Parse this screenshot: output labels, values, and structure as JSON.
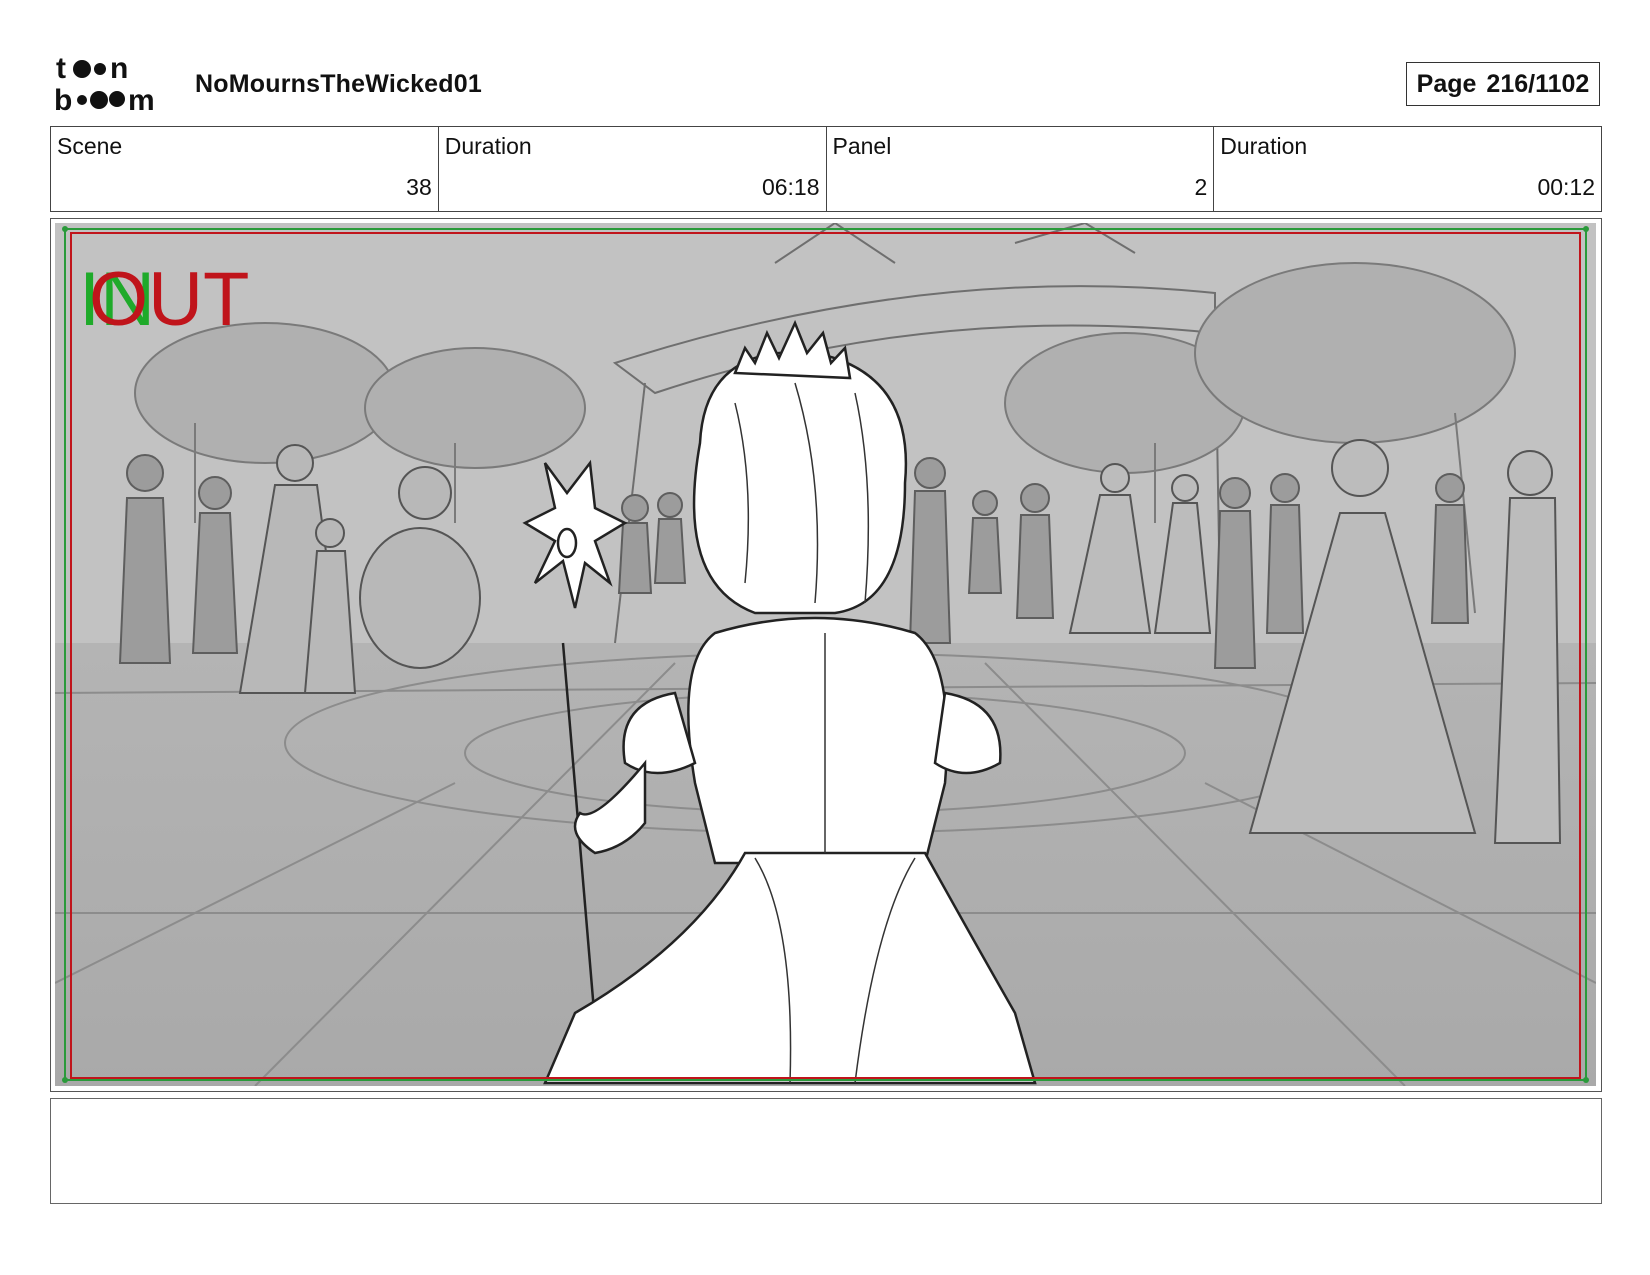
{
  "header": {
    "logo_text": "toon boom",
    "project_title": "NoMournsTheWicked01",
    "page_label": "Page",
    "page_number": "216/1102"
  },
  "info": [
    {
      "label": "Scene",
      "value": "38"
    },
    {
      "label": "Duration",
      "value": "06:18"
    },
    {
      "label": "Panel",
      "value": "2"
    },
    {
      "label": "Duration",
      "value": "00:12"
    }
  ],
  "panel": {
    "in_marker": "IN",
    "out_marker": "OUT",
    "colors": {
      "in": "#1faa2a",
      "out": "#c0141b",
      "safe_green": "#2a9a3a",
      "safe_red": "#c0141b",
      "background": "#bdbdbd"
    }
  },
  "notes": {
    "text": ""
  }
}
